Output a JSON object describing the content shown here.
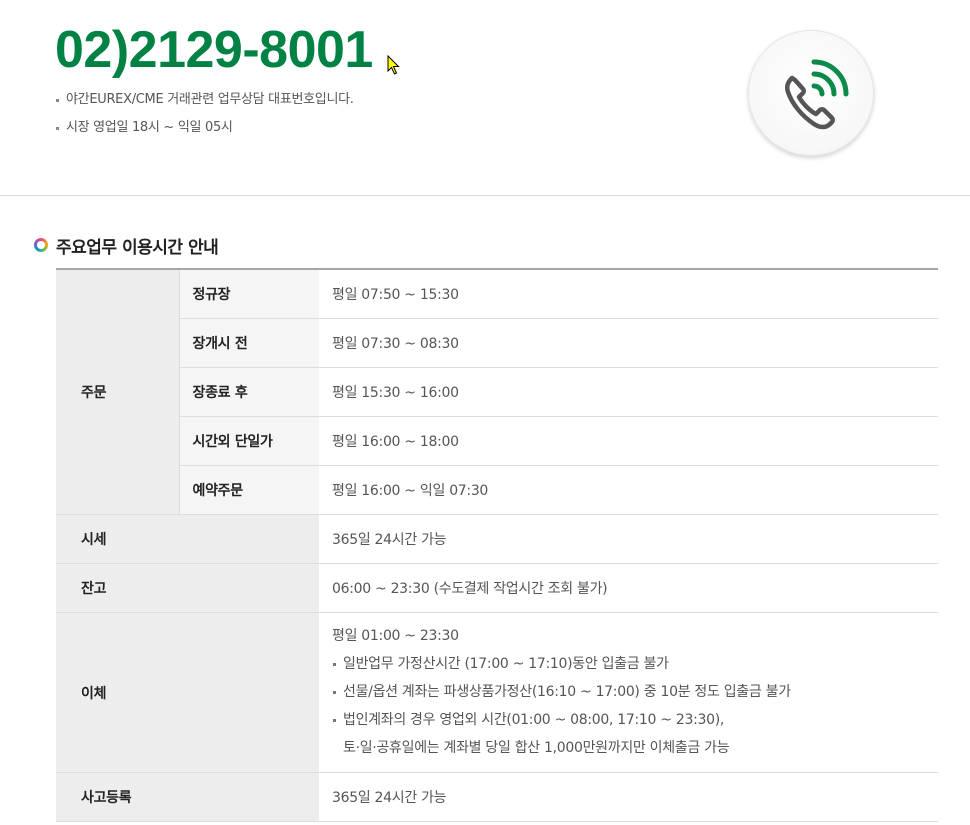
{
  "header": {
    "phone_number": "02)2129-8001",
    "notes": [
      "야간EUREX/CME 거래관련 업무상담 대표번호입니다.",
      "시장 영업일 18시 ~ 익일 05시"
    ],
    "icon": "phone-call-icon",
    "accent_color": "#008244"
  },
  "section": {
    "title": "주요업무 이용시간 안내",
    "icon": "ring-icon"
  },
  "table": {
    "order": {
      "label": "주문",
      "rows": [
        {
          "label": "정규장",
          "value": "평일 07:50 ~ 15:30"
        },
        {
          "label": "장개시 전",
          "value": "평일 07:30 ~ 08:30"
        },
        {
          "label": "장종료 후",
          "value": "평일 15:30 ~ 16:00"
        },
        {
          "label": "시간외 단일가",
          "value": "평일 16:00 ~ 18:00"
        },
        {
          "label": "예약주문",
          "value": "평일 16:00 ~ 익일 07:30"
        }
      ]
    },
    "quote": {
      "label": "시세",
      "value": "365일 24시간 가능"
    },
    "balance": {
      "label": "잔고",
      "value": "06:00 ~ 23:30 (수도결제 작업시간 조회 불가)"
    },
    "transfer": {
      "label": "이체",
      "value": "평일 01:00 ~ 23:30",
      "notes": [
        "일반업무 가정산시간 (17:00 ~ 17:10)동안 입출금 불가",
        "선물/옵션 계좌는 파생상품가정산(16:10 ~ 17:00) 중 10분 정도 입출금 불가",
        "법인계좌의 경우 영업외 시간(01:00 ~ 08:00, 17:10 ~ 23:30),",
        "토·일·공휴일에는 계좌별 당일 합산 1,000만원까지만 이체출금 가능"
      ]
    },
    "accident": {
      "label": "사고등록",
      "value": "365일 24시간 가능"
    }
  }
}
